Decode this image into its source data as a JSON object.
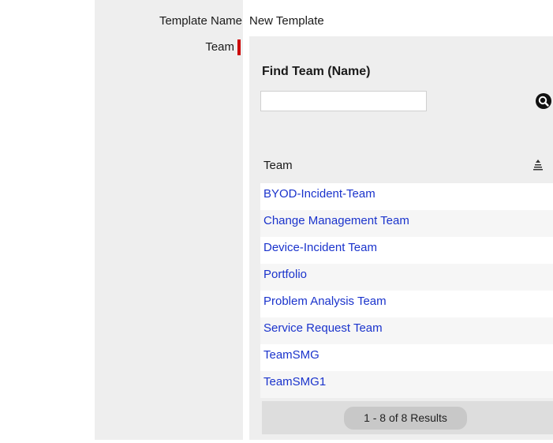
{
  "form": {
    "template_name_label": "Template Name",
    "template_name_value": "New Template",
    "team_label": "Team",
    "required_color": "#cc0000"
  },
  "team_picker": {
    "find_title": "Find Team (Name)",
    "search_value": "",
    "search_icon": "magnifier-icon",
    "column_header": "Team",
    "sort_icon": "sort-ascending-icon",
    "rows": [
      "BYOD-Incident-Team",
      "Change Management Team",
      "Device-Incident Team",
      "Portfolio",
      "Problem Analysis Team",
      "Service Request Team",
      "TeamSMG",
      "TeamSMG1"
    ],
    "results_text": "1 - 8 of 8 Results",
    "link_color": "#1a33cc"
  }
}
